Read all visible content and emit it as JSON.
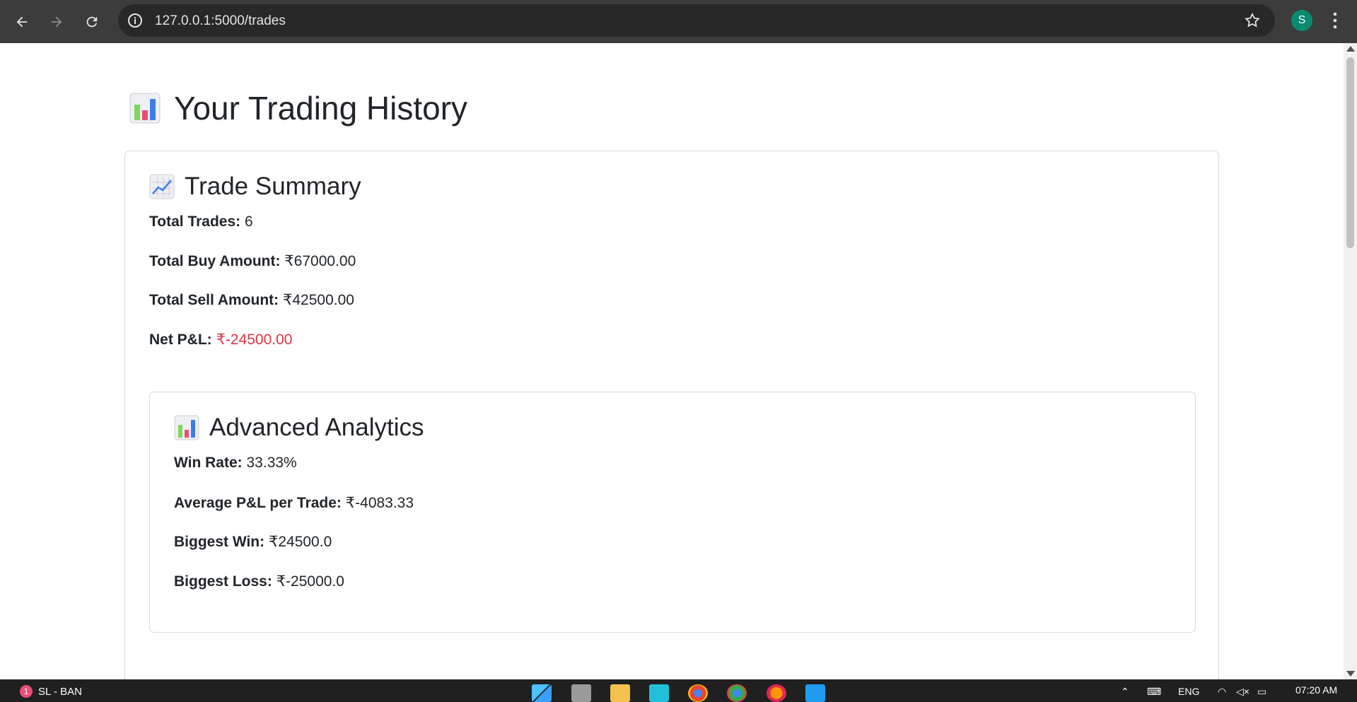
{
  "browser": {
    "url": "127.0.0.1:5000/trades",
    "avatar_letter": "S"
  },
  "page": {
    "title": "Your Trading History"
  },
  "summary": {
    "title": "Trade Summary",
    "total_trades_label": "Total Trades:",
    "total_trades_value": "6",
    "total_buy_label": "Total Buy Amount:",
    "total_buy_value": "₹67000.00",
    "total_sell_label": "Total Sell Amount:",
    "total_sell_value": "₹42500.00",
    "net_pl_label": "Net P&L:",
    "net_pl_value": "₹-24500.00"
  },
  "analytics": {
    "title": "Advanced Analytics",
    "win_rate_label": "Win Rate:",
    "win_rate_value": "33.33%",
    "avg_pl_label": "Average P&L per Trade:",
    "avg_pl_value": "₹-4083.33",
    "biggest_win_label": "Biggest Win:",
    "biggest_win_value": "₹24500.0",
    "biggest_loss_label": "Biggest Loss:",
    "biggest_loss_value": "₹-25000.0"
  },
  "taskbar": {
    "weather_badge": "1",
    "weather_text": "SL - BAN",
    "language": "ENG",
    "time": "07:20 AM"
  },
  "colors": {
    "negative": "#dc3545",
    "text": "#212529",
    "border": "#d7dadd"
  }
}
